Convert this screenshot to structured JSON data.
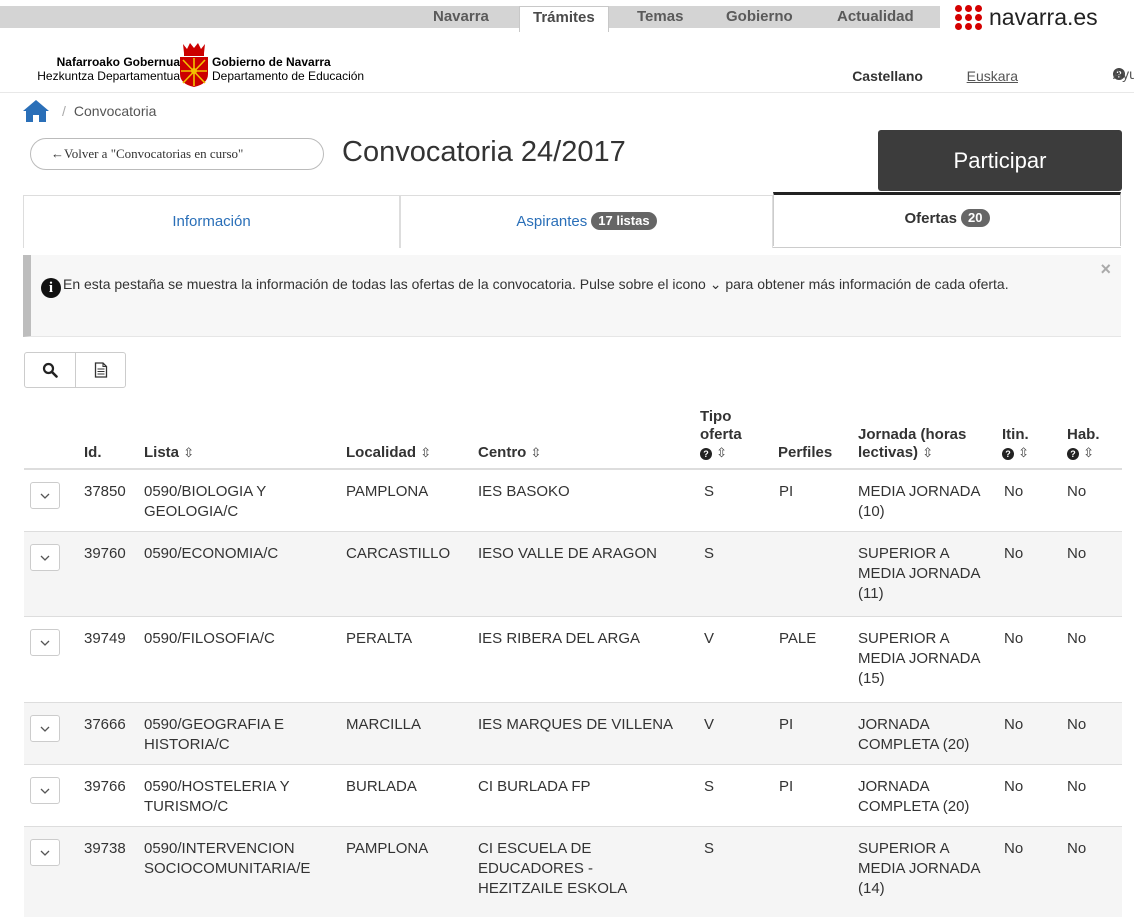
{
  "topnav": {
    "items": [
      {
        "label": "Navarra"
      },
      {
        "label": "Trámites"
      },
      {
        "label": "Temas"
      },
      {
        "label": "Gobierno"
      },
      {
        "label": "Actualidad"
      }
    ],
    "active": "Trámites",
    "brand": "navarra.es",
    "brand_color": "#d40000"
  },
  "header": {
    "gov_eu": "Nafarroako Gobernua",
    "dept_eu": "Hezkuntza Departamentua",
    "gov_es": "Gobierno de Navarra",
    "dept_es": "Departamento de Educación",
    "lang_active": "Castellano",
    "lang_other": "Euskara",
    "help": "Ayuda"
  },
  "breadcrumb": {
    "separator": "/",
    "current": "Convocatoria"
  },
  "page": {
    "back_label": "←Volver a \"Convocatorias en curso\"",
    "title": "Convocatoria 24/2017",
    "participar": "Participar"
  },
  "tabs": [
    {
      "label": "Información",
      "badge": ""
    },
    {
      "label": "Aspirantes",
      "badge": "17 listas"
    },
    {
      "label": "Ofertas",
      "badge": "20"
    }
  ],
  "alert": {
    "text": "En esta pestaña se muestra la información de todas las ofertas de la convocatoria. Pulse sobre el icono ⌄ para obtener más información de cada oferta.",
    "close": "×"
  },
  "table": {
    "headers": {
      "id": "Id.",
      "lista": "Lista",
      "localidad": "Localidad",
      "centro": "Centro",
      "tipo": "Tipo oferta",
      "perfiles": "Perfiles",
      "jornada": "Jornada (horas lectivas)",
      "itin": "Itin.",
      "hab": "Hab."
    },
    "rows": [
      {
        "id": "37850",
        "lista": "0590/BIOLOGIA Y GEOLOGIA/C",
        "localidad": "PAMPLONA",
        "centro": "IES BASOKO",
        "tipo": "S",
        "perfiles": "PI",
        "jornada": "MEDIA JORNADA (10)",
        "itin": "No",
        "hab": "No"
      },
      {
        "id": "39760",
        "lista": "0590/ECONOMIA/C",
        "localidad": "CARCASTILLO",
        "centro": "IESO VALLE DE ARAGON",
        "tipo": "S",
        "perfiles": "",
        "jornada": "SUPERIOR A MEDIA JORNADA (11)",
        "itin": "No",
        "hab": "No"
      },
      {
        "id": "39749",
        "lista": "0590/FILOSOFIA/C",
        "localidad": "PERALTA",
        "centro": "IES RIBERA DEL ARGA",
        "tipo": "V",
        "perfiles": "PALE",
        "jornada": "SUPERIOR A MEDIA JORNADA (15)",
        "itin": "No",
        "hab": "No"
      },
      {
        "id": "37666",
        "lista": "0590/GEOGRAFIA E HISTORIA/C",
        "localidad": "MARCILLA",
        "centro": "IES MARQUES DE VILLENA",
        "tipo": "V",
        "perfiles": "PI",
        "jornada": "JORNADA COMPLETA (20)",
        "itin": "No",
        "hab": "No"
      },
      {
        "id": "39766",
        "lista": "0590/HOSTELERIA Y TURISMO/C",
        "localidad": "BURLADA",
        "centro": "CI BURLADA FP",
        "tipo": "S",
        "perfiles": "PI",
        "jornada": "JORNADA COMPLETA (20)",
        "itin": "No",
        "hab": "No"
      },
      {
        "id": "39738",
        "lista": "0590/INTERVENCION SOCIOCOMUNITARIA/E",
        "localidad": "PAMPLONA",
        "centro": "CI ESCUELA DE EDUCADORES - HEZITZAILE ESKOLA",
        "tipo": "S",
        "perfiles": "",
        "jornada": "SUPERIOR A MEDIA JORNADA (14)",
        "itin": "No",
        "hab": "No"
      }
    ]
  }
}
